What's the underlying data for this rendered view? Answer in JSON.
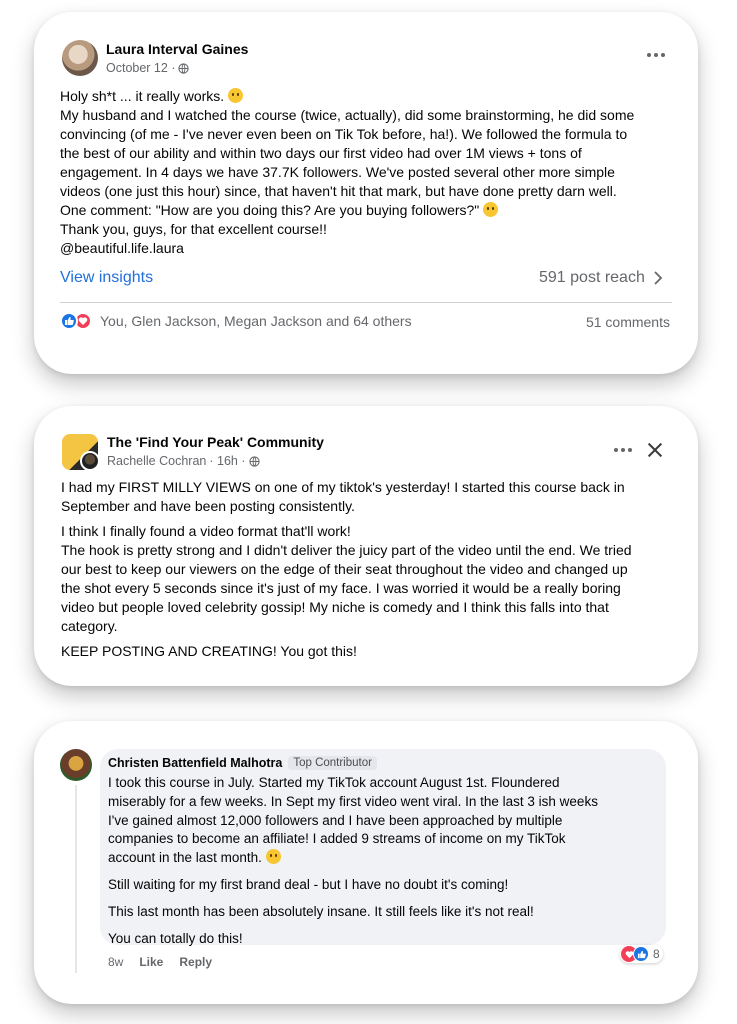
{
  "post1": {
    "author": "Laura Interval Gaines",
    "date": "October 12 ·",
    "body": [
      "Holy sh*t ... it really works.",
      "My husband and I watched the course (twice, actually), did some brainstorming, he did some",
      "convincing (of me - I've never even been on Tik Tok before, ha!). We followed the formula to",
      "the best of our ability and within two days our first video had over 1M views + tons of",
      "engagement. In 4 days we have 37.7K followers. We've posted several other more simple",
      "videos (one just this hour) since, that haven't hit that mark, but have done pretty darn well.",
      "One comment: \"How are you doing this? Are you buying followers?\"",
      "Thank you, guys, for that excellent course!!",
      "@beautiful.life.laura"
    ],
    "view_insights": "View insights",
    "reach": "591 post reach",
    "reactions_text": "You, Glen Jackson, Megan Jackson and 64 others",
    "comments": "51 comments"
  },
  "post2": {
    "group": "The 'Find Your Peak' Community",
    "author": "Rachelle Cochran",
    "date": "· 16h ·",
    "paragraphs": [
      [
        "I had my FIRST MILLY VIEWS on one of my tiktok's yesterday! I started this course back in",
        "September and have been posting consistently."
      ],
      [
        "I think I finally found a video format that'll work!",
        "The hook is pretty strong and I didn't deliver the juicy part of the video until the end. We tried",
        "our best to keep our viewers on the edge of their seat throughout the video and changed up",
        "the shot every 5 seconds since it's just of my face. I was worried it would be a really boring",
        "video but people loved celebrity gossip! My niche is comedy and I think this falls into that",
        "category."
      ],
      [
        "KEEP POSTING AND CREATING! You got this!"
      ]
    ]
  },
  "comment": {
    "author": "Christen Battenfield Malhotra",
    "badge": "Top Contributor",
    "paragraphs": [
      [
        "I took this course in July. Started my TikTok account August 1st. Floundered",
        "miserably for a few weeks. In Sept my first video went viral. In the last 3 ish weeks",
        "I've gained almost 12,000 followers and I have been approached by multiple",
        "companies to become an affiliate! I added 9 streams of income on my TikTok",
        "account in the last month."
      ],
      [
        "Still waiting for my first brand deal - but I have no doubt it's coming!"
      ],
      [
        "This last month has been absolutely insane. It still feels like it's not real!"
      ],
      [
        "You can totally do this!"
      ]
    ],
    "time": "8w",
    "like": "Like",
    "reply": "Reply",
    "reaction_count": "8"
  },
  "colors": {
    "link": "#216fdb",
    "like": "#1b74e4",
    "love": "#f33e58",
    "muted": "#65676b"
  },
  "icons": [
    "more-icon",
    "globe-icon",
    "chevron-right-icon",
    "close-icon",
    "like-reaction-icon",
    "love-reaction-icon"
  ]
}
